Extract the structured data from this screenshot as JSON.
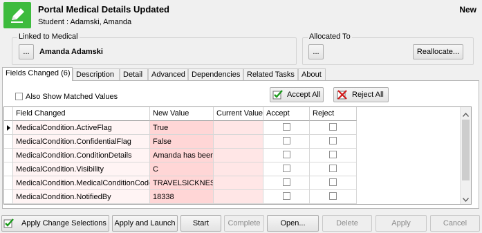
{
  "header": {
    "title": "Portal Medical Details Updated",
    "student_label": "Student : Adamski, Amanda",
    "status": "New",
    "icon": "pencil-icon",
    "accent_color": "#3dbb3d"
  },
  "linked": {
    "group_title": "Linked to Medical",
    "browse_label": "...",
    "name": "Amanda Adamski"
  },
  "allocated": {
    "group_title": "Allocated To",
    "browse_label": "...",
    "reallocate_label": "Reallocate..."
  },
  "tabs": [
    {
      "label": "Fields Changed (6)",
      "active": true
    },
    {
      "label": "Description"
    },
    {
      "label": "Detail"
    },
    {
      "label": "Advanced"
    },
    {
      "label": "Dependencies"
    },
    {
      "label": "Related Tasks"
    },
    {
      "label": "About"
    }
  ],
  "options": {
    "show_matched_label": "Also Show Matched Values",
    "accept_all_label": "Accept All",
    "reject_all_label": "Reject All"
  },
  "grid": {
    "columns": [
      "Field Changed",
      "New Value",
      "Current Value",
      "Accept",
      "Reject"
    ],
    "rows": [
      {
        "field": "MedicalCondition.ActiveFlag",
        "new_value": "True",
        "current_value": ""
      },
      {
        "field": "MedicalCondition.ConfidentialFlag",
        "new_value": "False",
        "current_value": ""
      },
      {
        "field": "MedicalCondition.ConditionDetails",
        "new_value": "Amanda has been",
        "current_value": ""
      },
      {
        "field": "MedicalCondition.Visibility",
        "new_value": "C",
        "current_value": ""
      },
      {
        "field": "MedicalCondition.MedicalConditionCode",
        "new_value": "TRAVELSICKNESS",
        "current_value": ""
      },
      {
        "field": "MedicalCondition.NotifiedBy",
        "new_value": "18338",
        "current_value": ""
      }
    ]
  },
  "footer": {
    "apply_changes_label": "Apply Change Selections",
    "apply_launch_label": "Apply and Launch",
    "start_label": "Start",
    "complete_label": "Complete",
    "open_label": "Open...",
    "delete_label": "Delete",
    "apply_label": "Apply",
    "cancel_label": "Cancel"
  }
}
